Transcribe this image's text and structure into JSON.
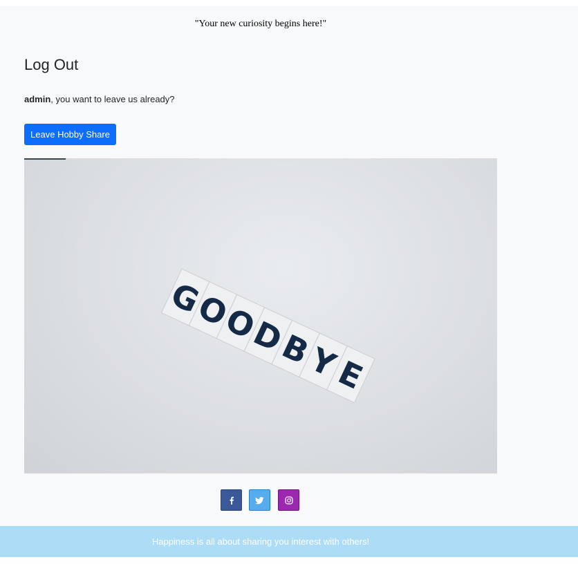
{
  "header": {
    "tagline": "\"Your new curiosity begins here!\""
  },
  "main": {
    "title": "Log Out",
    "username": "admin",
    "message_suffix": ", you want to leave us already?",
    "leave_button_label": "Leave Hobby Share",
    "image": {
      "letters": [
        "G",
        "O",
        "O",
        "D",
        "B",
        "Y",
        "E"
      ]
    }
  },
  "social": [
    {
      "name": "facebook-icon",
      "color": "#3b5998"
    },
    {
      "name": "twitter-icon",
      "color": "#55acee"
    },
    {
      "name": "instagram-icon",
      "color": "#9c27b0"
    }
  ],
  "footer": {
    "text": "Happiness is all about sharing you interest with others!",
    "band_color": "#addcf7"
  },
  "colors": {
    "primary": "#0d6efd",
    "background": "#f8f9fa"
  }
}
